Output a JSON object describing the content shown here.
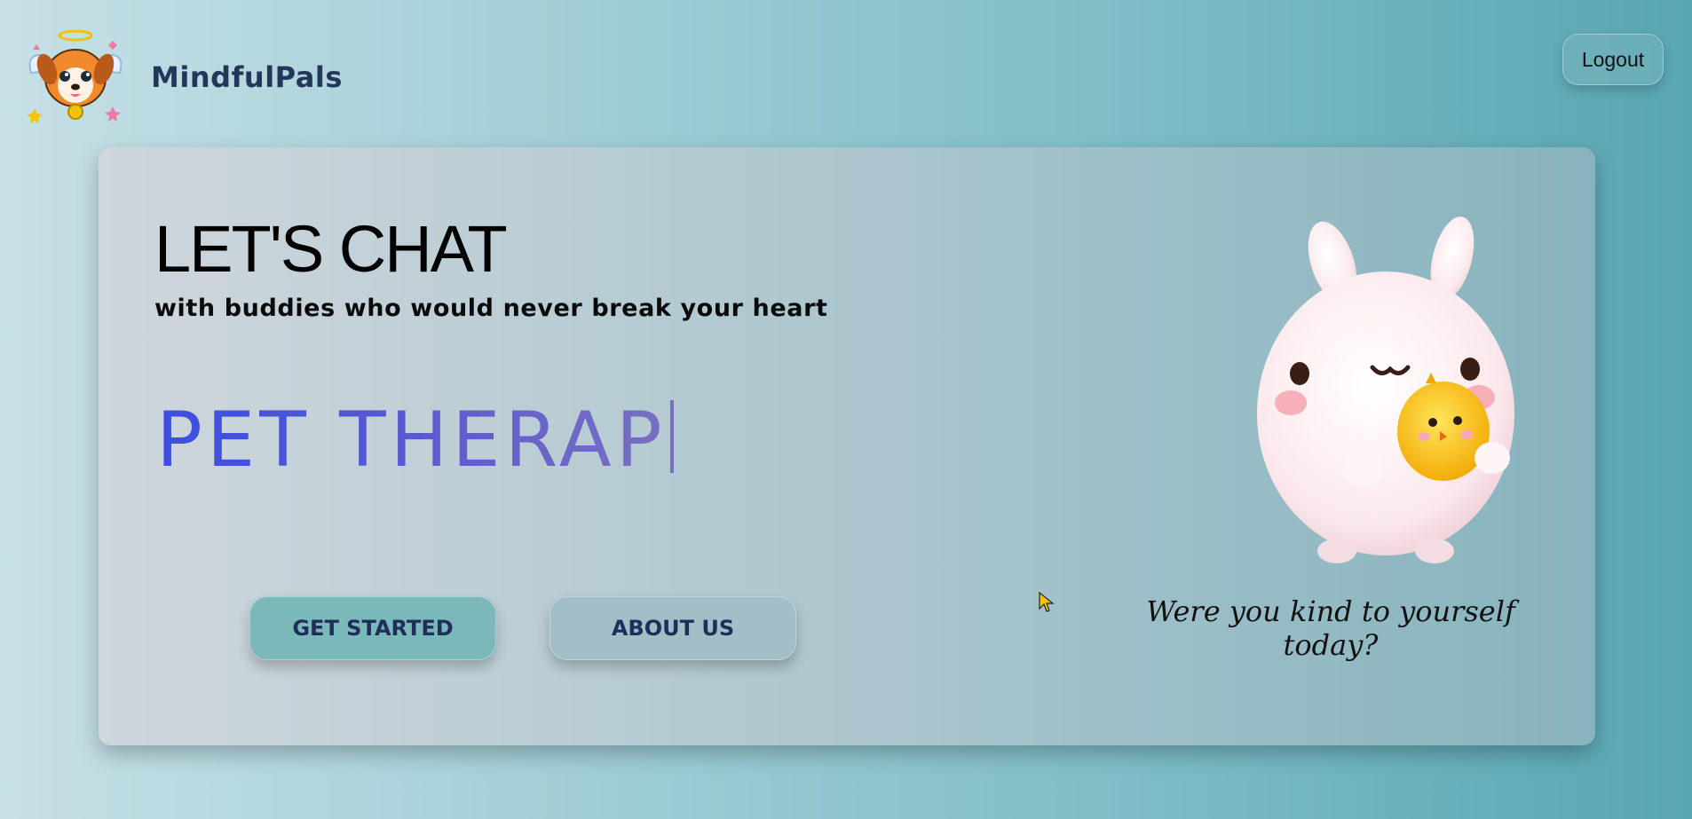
{
  "header": {
    "brand": "MindfulPals",
    "logout_label": "Logout",
    "logo_icon": "angel-puppy-logo-icon"
  },
  "hero": {
    "headline": "LET'S CHAT",
    "subheadline": "with buddies who would never break your heart",
    "typed_text": "PET THERAP",
    "buttons": {
      "get_started": "GET STARTED",
      "about_us": "ABOUT US"
    },
    "quote": "Were you kind to yourself today?",
    "mascot_icon": "bunny-holding-chick-icon"
  },
  "colors": {
    "brand_text": "#24365a",
    "typed_gradient_start": "#3a4ee0",
    "typed_gradient_end": "#7a70c0",
    "get_started_bg": "#7ab8ba",
    "about_us_bg": "#a2bec6",
    "button_text": "#1f2f5a"
  }
}
